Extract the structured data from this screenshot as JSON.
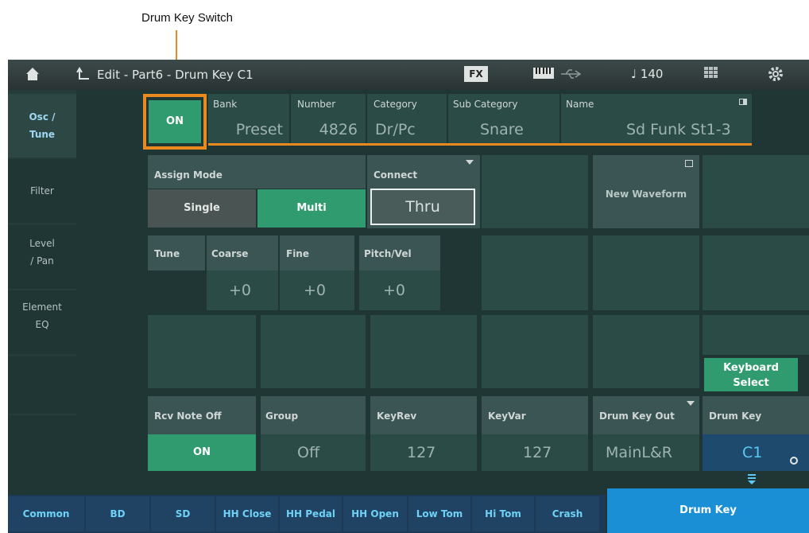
{
  "callout": {
    "label": "Drum Key Switch"
  },
  "topbar": {
    "title": "Edit - Part6 - Drum Key C1",
    "fx": "FX",
    "tempo": "♩ 140"
  },
  "sidebar": {
    "items": [
      {
        "label": "Osc /\nTune"
      },
      {
        "label": "Filter"
      },
      {
        "label": "Level\n/ Pan"
      },
      {
        "label": "Element\nEQ"
      }
    ]
  },
  "head": {
    "switch": "ON",
    "bank_label": "Bank",
    "bank_value": "Preset",
    "number_label": "Number",
    "number_value": "4826",
    "category_label": "Category",
    "category_value": "Dr/Pc",
    "subcat_label": "Sub Category",
    "subcat_value": "Snare",
    "name_label": "Name",
    "name_value": "Sd Funk St1-3"
  },
  "assign": {
    "label": "Assign Mode",
    "single": "Single",
    "multi": "Multi"
  },
  "connect": {
    "label": "Connect",
    "value": "Thru"
  },
  "new_waveform": "New Waveform",
  "tune": {
    "label": "Tune",
    "coarse_label": "Coarse",
    "coarse": "+0",
    "fine_label": "Fine",
    "fine": "+0",
    "pitchvel_label": "Pitch/Vel",
    "pitchvel": "+0"
  },
  "keyboard_select": "Keyboard\nSelect",
  "bottom": {
    "rcv_label": "Rcv Note Off",
    "rcv": "ON",
    "group_label": "Group",
    "group": "Off",
    "keyrev_label": "KeyRev",
    "keyrev": "127",
    "keyvar_label": "KeyVar",
    "keyvar": "127",
    "out_label": "Drum Key Out",
    "out": "MainL&R",
    "key_label": "Drum Key",
    "key": "C1"
  },
  "tabs": [
    "Common",
    "BD",
    "SD",
    "HH Close",
    "HH Pedal",
    "HH Open",
    "Low Tom",
    "Hi Tom",
    "Crash"
  ],
  "active_tab": "Drum Key",
  "colors": {
    "accent": "#e98a1f",
    "green": "#2f9b6e",
    "blue": "#1b8fd6"
  }
}
